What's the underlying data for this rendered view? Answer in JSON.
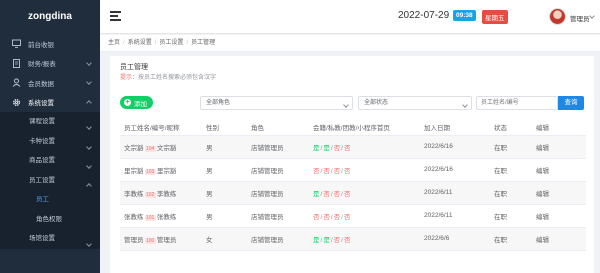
{
  "brand": "zongdina",
  "menu": [
    {
      "label": "前台收银",
      "icon": "monitor-icon"
    },
    {
      "label": "财务/报表",
      "icon": "document-icon"
    },
    {
      "label": "会员数据",
      "icon": "user-icon"
    },
    {
      "label": "系统设置",
      "icon": "gear-icon"
    }
  ],
  "submenu": {
    "course": "课程设置",
    "card": "卡种设置",
    "goods": "商品设置",
    "staff": "员工设置",
    "staff_children": [
      "员工",
      "角色权限"
    ],
    "venue": "场馆设置"
  },
  "header": {
    "date": "2022-07-29",
    "time": "09:38",
    "weekday": "星期五",
    "username": "管理员"
  },
  "breadcrumb": [
    "主页",
    "系统设置",
    "员工设置",
    "员工管理"
  ],
  "page": {
    "title": "员工管理",
    "hint_label": "提示：",
    "hint_text": "按员工姓名搜索必须包含汉字"
  },
  "toolbar": {
    "add_label": "添加",
    "role_select": "全部角色",
    "status_select": "全部状态",
    "search_placeholder": "员工姓名/编号",
    "search_label": "查询"
  },
  "table": {
    "columns": [
      "员工姓名/编号/昵称",
      "性别",
      "角色",
      "会籍/私教/团教/小程序首页",
      "加入日期",
      "状态",
      "编辑"
    ],
    "rows": [
      {
        "name": "文宗豁",
        "code": "104",
        "nick": "文宗豁",
        "gender": "男",
        "role": "店铺管理员",
        "perms": [
          "是",
          "是",
          "否",
          "否"
        ],
        "date": "2022/6/16",
        "status": "在职",
        "action": "编辑"
      },
      {
        "name": "里宗豁",
        "code": "103",
        "nick": "里宗豁",
        "gender": "男",
        "role": "店铺管理员",
        "perms": [
          "否",
          "否",
          "否",
          "否"
        ],
        "date": "2022/6/16",
        "status": "在职",
        "action": "编辑"
      },
      {
        "name": "李教练",
        "code": "102",
        "nick": "李教练",
        "gender": "男",
        "role": "店铺管理员",
        "perms": [
          "是",
          "否",
          "否",
          "否"
        ],
        "date": "2022/6/11",
        "status": "在职",
        "action": "编辑"
      },
      {
        "name": "张教练",
        "code": "101",
        "nick": "张教练",
        "gender": "男",
        "role": "店铺管理员",
        "perms": [
          "否",
          "否",
          "否",
          "否"
        ],
        "date": "2022/6/11",
        "status": "在职",
        "action": "编辑"
      },
      {
        "name": "管理员",
        "code": "100",
        "nick": "管理员",
        "gender": "女",
        "role": "店铺管理员",
        "perms": [
          "是",
          "是",
          "否",
          "否"
        ],
        "date": "2022/6/6",
        "status": "在职",
        "action": "编辑"
      }
    ]
  },
  "colors": {
    "sidebar_bg": "#1f2d3d",
    "accent": "#1e88e5",
    "success": "#13ce66",
    "danger": "#f56c6c"
  }
}
